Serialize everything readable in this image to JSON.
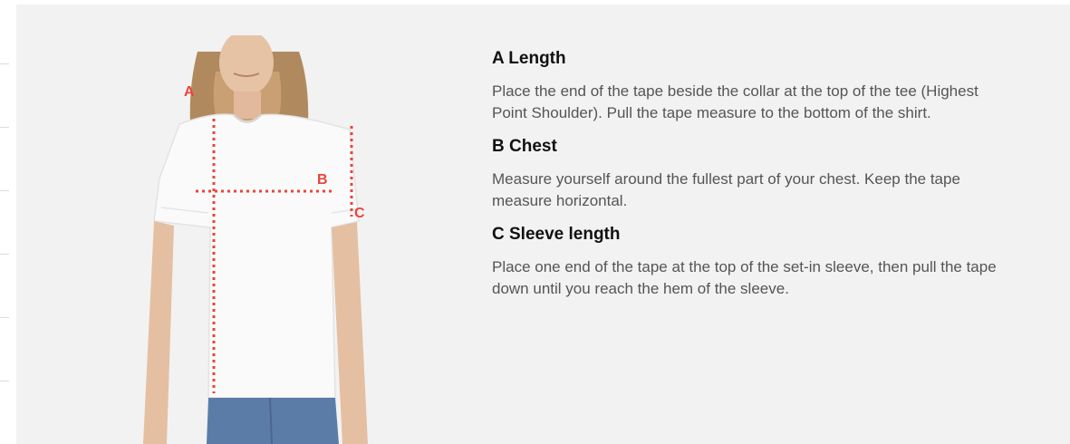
{
  "figure": {
    "labels": {
      "a": "A",
      "b": "B",
      "c": "C"
    },
    "accent_color": "#e8453c"
  },
  "guide": {
    "sections": [
      {
        "title": "A Length",
        "text_lines": [
          "Place the end of the tape beside the collar at the top of the tee (Highest",
          "Point Shoulder). Pull the tape measure to the bottom of the shirt."
        ]
      },
      {
        "title": "B Chest",
        "text_lines": [
          "Measure yourself around the fullest part of your chest. Keep the tape",
          "measure horizontal."
        ]
      },
      {
        "title": "C Sleeve length",
        "text_lines": [
          "Place one end of the tape at the top of the set-in sleeve, then pull the tape",
          "down until you reach the hem of the sleeve."
        ]
      }
    ]
  }
}
